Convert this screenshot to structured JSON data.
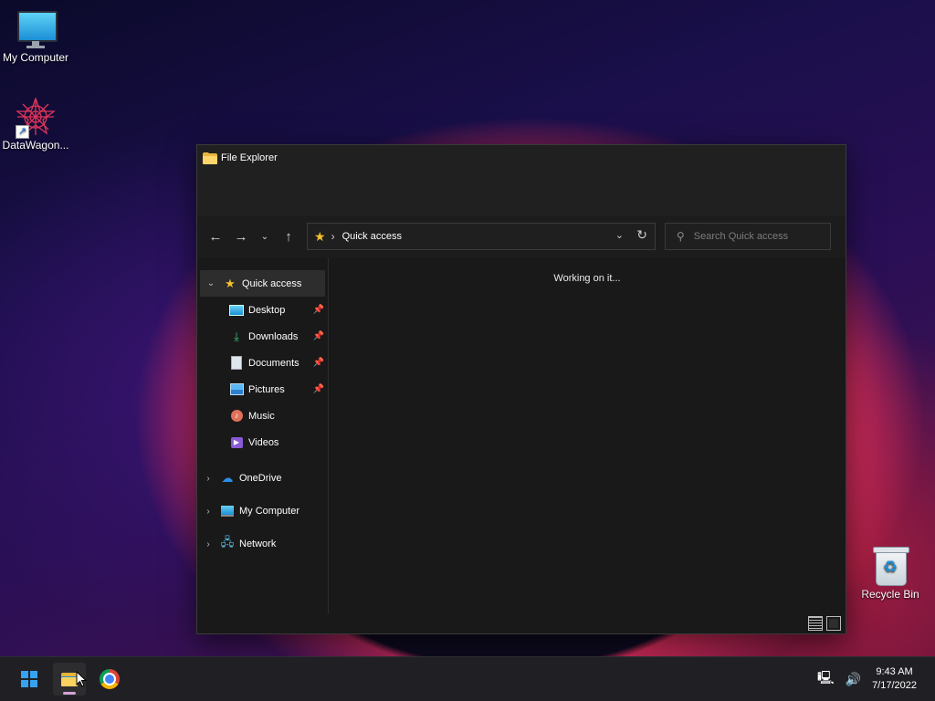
{
  "desktop": {
    "icons": [
      {
        "label": "My Computer"
      },
      {
        "label": "DataWagon..."
      },
      {
        "label": "Recycle Bin"
      }
    ]
  },
  "explorer": {
    "title": "File Explorer",
    "address": {
      "path": "Quick access"
    },
    "search": {
      "placeholder": "Search Quick access"
    },
    "status_message": "Working on it...",
    "sidebar": {
      "quick_access": "Quick access",
      "items": [
        {
          "label": "Desktop",
          "icon": "desktop-icon",
          "pinned": true
        },
        {
          "label": "Downloads",
          "icon": "download-icon",
          "pinned": true
        },
        {
          "label": "Documents",
          "icon": "document-icon",
          "pinned": true
        },
        {
          "label": "Pictures",
          "icon": "pictures-icon",
          "pinned": true
        },
        {
          "label": "Music",
          "icon": "music-icon",
          "pinned": false
        },
        {
          "label": "Videos",
          "icon": "videos-icon",
          "pinned": false
        }
      ],
      "onedrive": "OneDrive",
      "my_computer": "My Computer",
      "network": "Network"
    }
  },
  "taskbar": {
    "clock": {
      "time": "9:43 AM",
      "date": "7/17/2022"
    }
  },
  "colors": {
    "accent": "#37a2f1",
    "folder": "#e8b640",
    "star": "#f3c12a"
  }
}
